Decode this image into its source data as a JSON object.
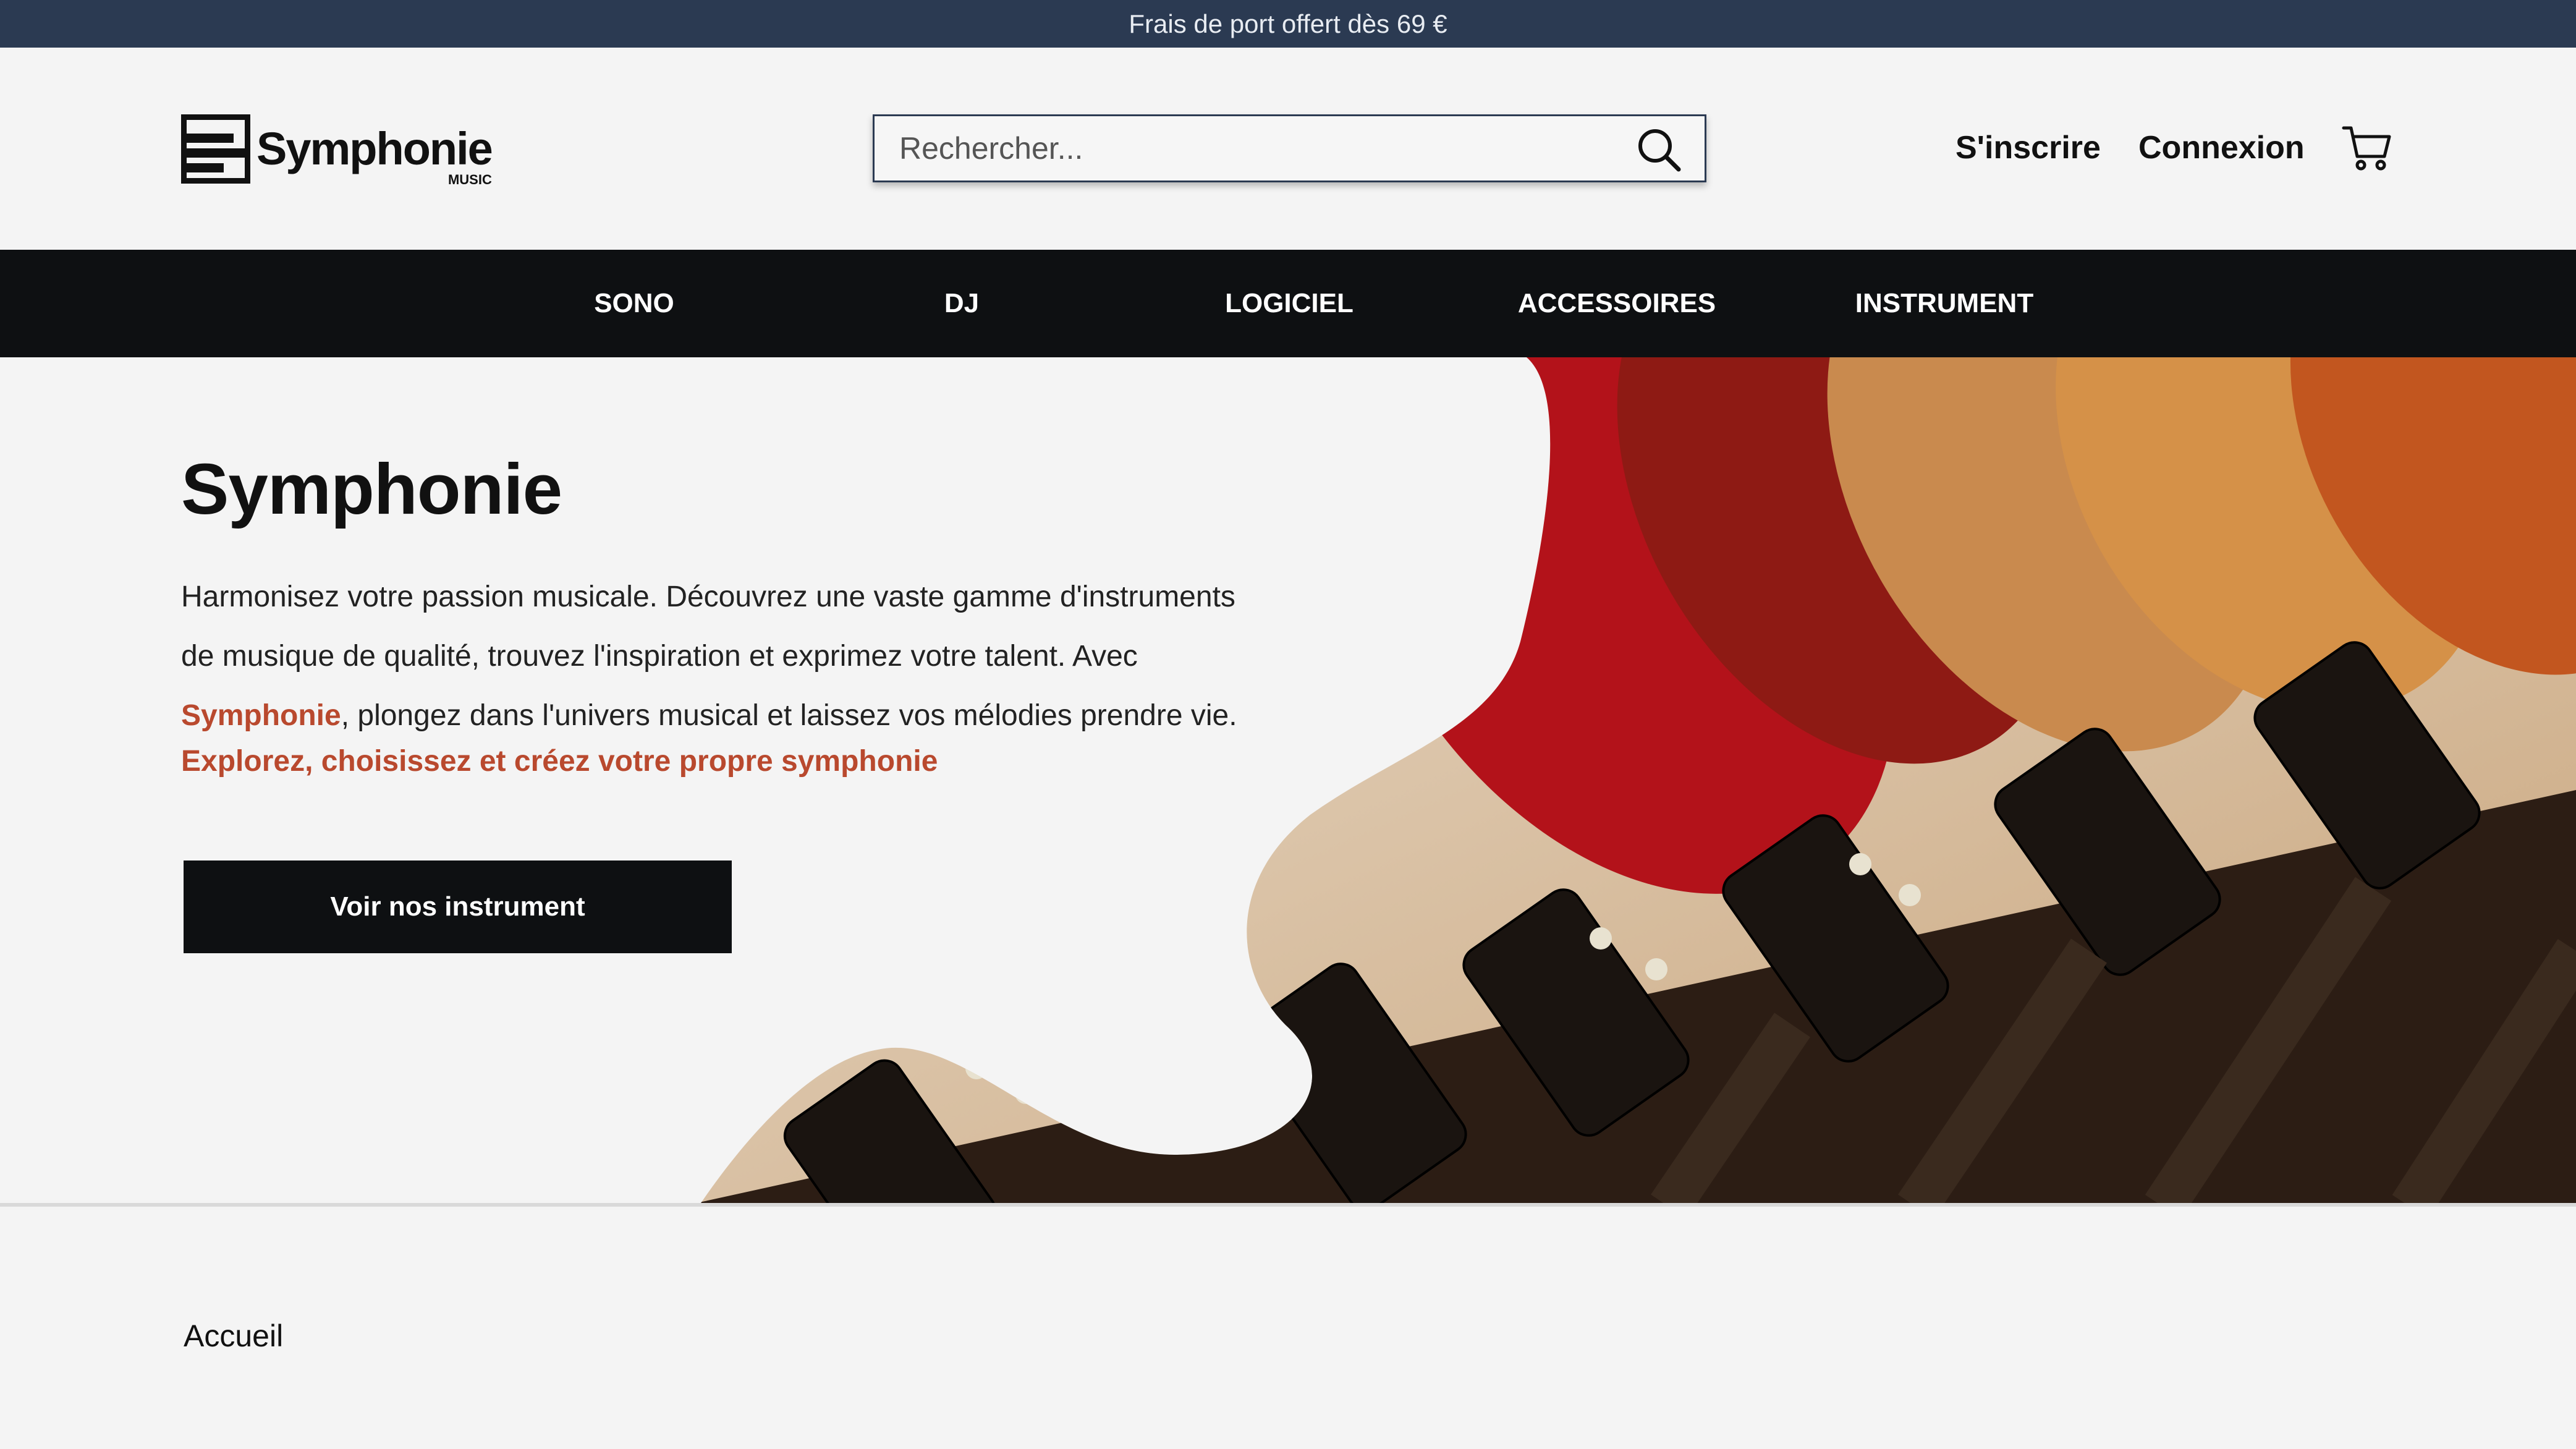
{
  "promo": {
    "text": "Frais de port offert dès 69 €"
  },
  "header": {
    "logo": {
      "name": "Symphonie",
      "sub": "MUSIC"
    },
    "search": {
      "placeholder": "Rechercher..."
    },
    "signup_label": "S'inscrire",
    "login_label": "Connexion"
  },
  "nav": {
    "items": [
      "SONO",
      "DJ",
      "LOGICIEL",
      "ACCESSOIRES",
      "INSTRUMENT"
    ]
  },
  "hero": {
    "title": "Symphonie",
    "text_before": "Harmonisez votre passion musicale. Découvrez une vaste gamme d'instruments de musique de qualité, trouvez l'inspiration et exprimez votre talent. Avec ",
    "text_accent": "Symphonie",
    "text_after": ", plongez dans l'univers musical et laissez vos mélodies prendre vie.",
    "tagline": "Explorez, choisissez et créez votre propre symphonie",
    "cta_label": "Voir nos instrument"
  },
  "breadcrumb": {
    "current": "Accueil"
  },
  "colors": {
    "accent": "#b9492e",
    "promo_bg": "#2b3a52",
    "nav_bg": "#0e1012"
  }
}
